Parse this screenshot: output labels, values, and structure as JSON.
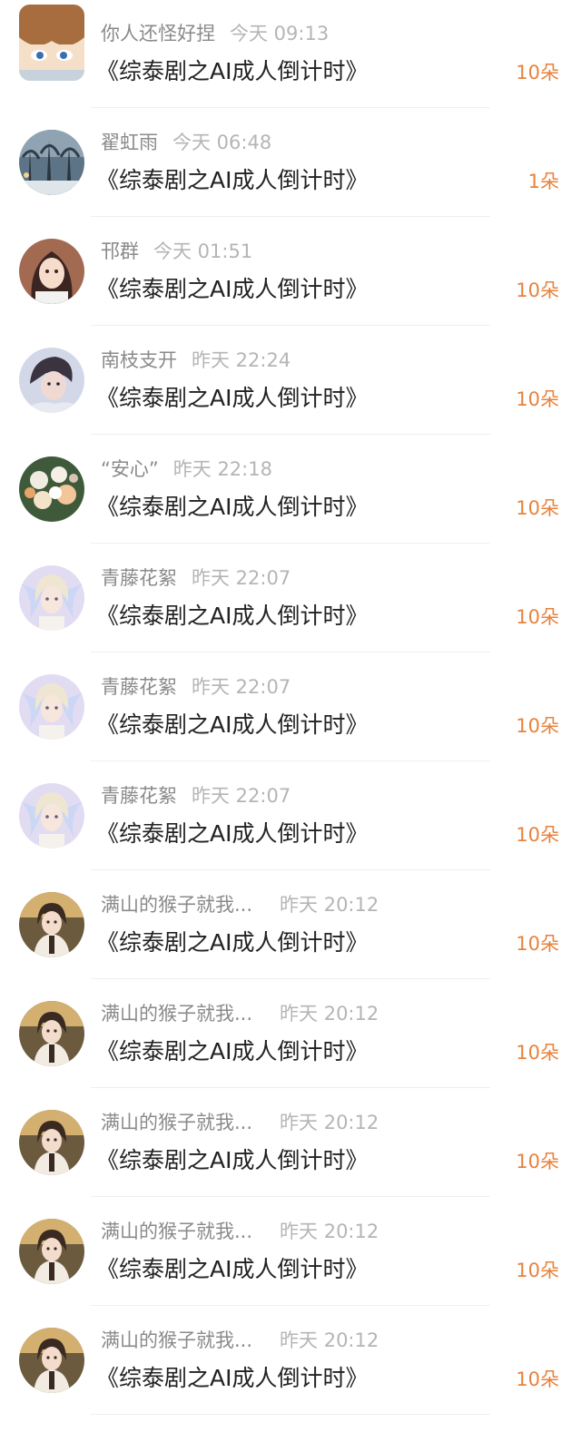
{
  "colors": {
    "name": "#8a8a8a",
    "time": "#b5b5b5",
    "title": "#222222",
    "amount": "#e8823c",
    "divider": "#efefef"
  },
  "items": [
    {
      "name": "你人还怪好捏",
      "time": "今天 09:13",
      "title": "《综泰剧之AI成人倒计时》",
      "amount": "10朵",
      "avatar_icon": "cartoon-boy-avatar"
    },
    {
      "name": "翟虹雨",
      "time": "今天 06:48",
      "title": "《综泰剧之AI成人倒计时》",
      "amount": "1朵",
      "avatar_icon": "winter-trees-avatar"
    },
    {
      "name": "邗群",
      "time": "今天 01:51",
      "title": "《综泰剧之AI成人倒计时》",
      "amount": "10朵",
      "avatar_icon": "girl-portrait-avatar"
    },
    {
      "name": "南枝支开",
      "time": "昨天 22:24",
      "title": "《综泰剧之AI成人倒计时》",
      "amount": "10朵",
      "avatar_icon": "man-portrait-avatar"
    },
    {
      "name": "“安心”",
      "time": "昨天 22:18",
      "title": "《综泰剧之AI成人倒计时》",
      "amount": "10朵",
      "avatar_icon": "flower-bouquet-avatar"
    },
    {
      "name": "青藤花絮",
      "time": "昨天 22:07",
      "title": "《综泰剧之AI成人倒计时》",
      "amount": "10朵",
      "avatar_icon": "fairy-anime-avatar"
    },
    {
      "name": "青藤花絮",
      "time": "昨天 22:07",
      "title": "《综泰剧之AI成人倒计时》",
      "amount": "10朵",
      "avatar_icon": "fairy-anime-avatar"
    },
    {
      "name": "青藤花絮",
      "time": "昨天 22:07",
      "title": "《综泰剧之AI成人倒计时》",
      "amount": "10朵",
      "avatar_icon": "fairy-anime-avatar"
    },
    {
      "name": "满山的猴子就我...",
      "time": "昨天 20:12",
      "title": "《综泰剧之AI成人倒计时》",
      "amount": "10朵",
      "avatar_icon": "anime-boy-avatar"
    },
    {
      "name": "满山的猴子就我...",
      "time": "昨天 20:12",
      "title": "《综泰剧之AI成人倒计时》",
      "amount": "10朵",
      "avatar_icon": "anime-boy-avatar"
    },
    {
      "name": "满山的猴子就我...",
      "time": "昨天 20:12",
      "title": "《综泰剧之AI成人倒计时》",
      "amount": "10朵",
      "avatar_icon": "anime-boy-avatar"
    },
    {
      "name": "满山的猴子就我...",
      "time": "昨天 20:12",
      "title": "《综泰剧之AI成人倒计时》",
      "amount": "10朵",
      "avatar_icon": "anime-boy-avatar"
    },
    {
      "name": "满山的猴子就我...",
      "time": "昨天 20:12",
      "title": "《综泰剧之AI成人倒计时》",
      "amount": "10朵",
      "avatar_icon": "anime-boy-avatar"
    }
  ]
}
